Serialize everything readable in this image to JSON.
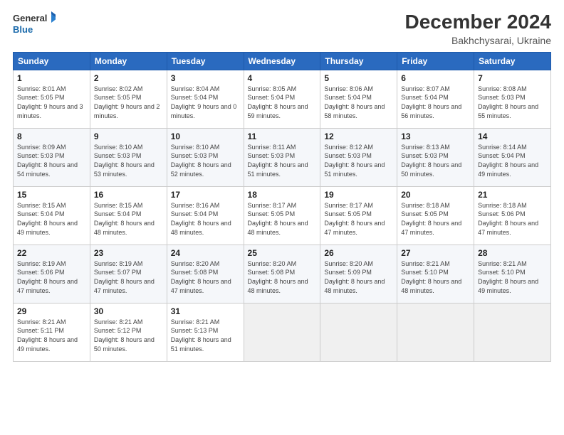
{
  "logo": {
    "line1": "General",
    "line2": "Blue"
  },
  "title": "December 2024",
  "subtitle": "Bakhchysarai, Ukraine",
  "weekdays": [
    "Sunday",
    "Monday",
    "Tuesday",
    "Wednesday",
    "Thursday",
    "Friday",
    "Saturday"
  ],
  "weeks": [
    [
      {
        "day": "1",
        "sunrise": "8:01 AM",
        "sunset": "5:05 PM",
        "daylight": "9 hours and 3 minutes."
      },
      {
        "day": "2",
        "sunrise": "8:02 AM",
        "sunset": "5:05 PM",
        "daylight": "9 hours and 2 minutes."
      },
      {
        "day": "3",
        "sunrise": "8:04 AM",
        "sunset": "5:04 PM",
        "daylight": "9 hours and 0 minutes."
      },
      {
        "day": "4",
        "sunrise": "8:05 AM",
        "sunset": "5:04 PM",
        "daylight": "8 hours and 59 minutes."
      },
      {
        "day": "5",
        "sunrise": "8:06 AM",
        "sunset": "5:04 PM",
        "daylight": "8 hours and 58 minutes."
      },
      {
        "day": "6",
        "sunrise": "8:07 AM",
        "sunset": "5:04 PM",
        "daylight": "8 hours and 56 minutes."
      },
      {
        "day": "7",
        "sunrise": "8:08 AM",
        "sunset": "5:03 PM",
        "daylight": "8 hours and 55 minutes."
      }
    ],
    [
      {
        "day": "8",
        "sunrise": "8:09 AM",
        "sunset": "5:03 PM",
        "daylight": "8 hours and 54 minutes."
      },
      {
        "day": "9",
        "sunrise": "8:10 AM",
        "sunset": "5:03 PM",
        "daylight": "8 hours and 53 minutes."
      },
      {
        "day": "10",
        "sunrise": "8:10 AM",
        "sunset": "5:03 PM",
        "daylight": "8 hours and 52 minutes."
      },
      {
        "day": "11",
        "sunrise": "8:11 AM",
        "sunset": "5:03 PM",
        "daylight": "8 hours and 51 minutes."
      },
      {
        "day": "12",
        "sunrise": "8:12 AM",
        "sunset": "5:03 PM",
        "daylight": "8 hours and 51 minutes."
      },
      {
        "day": "13",
        "sunrise": "8:13 AM",
        "sunset": "5:03 PM",
        "daylight": "8 hours and 50 minutes."
      },
      {
        "day": "14",
        "sunrise": "8:14 AM",
        "sunset": "5:04 PM",
        "daylight": "8 hours and 49 minutes."
      }
    ],
    [
      {
        "day": "15",
        "sunrise": "8:15 AM",
        "sunset": "5:04 PM",
        "daylight": "8 hours and 49 minutes."
      },
      {
        "day": "16",
        "sunrise": "8:15 AM",
        "sunset": "5:04 PM",
        "daylight": "8 hours and 48 minutes."
      },
      {
        "day": "17",
        "sunrise": "8:16 AM",
        "sunset": "5:04 PM",
        "daylight": "8 hours and 48 minutes."
      },
      {
        "day": "18",
        "sunrise": "8:17 AM",
        "sunset": "5:05 PM",
        "daylight": "8 hours and 48 minutes."
      },
      {
        "day": "19",
        "sunrise": "8:17 AM",
        "sunset": "5:05 PM",
        "daylight": "8 hours and 47 minutes."
      },
      {
        "day": "20",
        "sunrise": "8:18 AM",
        "sunset": "5:05 PM",
        "daylight": "8 hours and 47 minutes."
      },
      {
        "day": "21",
        "sunrise": "8:18 AM",
        "sunset": "5:06 PM",
        "daylight": "8 hours and 47 minutes."
      }
    ],
    [
      {
        "day": "22",
        "sunrise": "8:19 AM",
        "sunset": "5:06 PM",
        "daylight": "8 hours and 47 minutes."
      },
      {
        "day": "23",
        "sunrise": "8:19 AM",
        "sunset": "5:07 PM",
        "daylight": "8 hours and 47 minutes."
      },
      {
        "day": "24",
        "sunrise": "8:20 AM",
        "sunset": "5:08 PM",
        "daylight": "8 hours and 47 minutes."
      },
      {
        "day": "25",
        "sunrise": "8:20 AM",
        "sunset": "5:08 PM",
        "daylight": "8 hours and 48 minutes."
      },
      {
        "day": "26",
        "sunrise": "8:20 AM",
        "sunset": "5:09 PM",
        "daylight": "8 hours and 48 minutes."
      },
      {
        "day": "27",
        "sunrise": "8:21 AM",
        "sunset": "5:10 PM",
        "daylight": "8 hours and 48 minutes."
      },
      {
        "day": "28",
        "sunrise": "8:21 AM",
        "sunset": "5:10 PM",
        "daylight": "8 hours and 49 minutes."
      }
    ],
    [
      {
        "day": "29",
        "sunrise": "8:21 AM",
        "sunset": "5:11 PM",
        "daylight": "8 hours and 49 minutes."
      },
      {
        "day": "30",
        "sunrise": "8:21 AM",
        "sunset": "5:12 PM",
        "daylight": "8 hours and 50 minutes."
      },
      {
        "day": "31",
        "sunrise": "8:21 AM",
        "sunset": "5:13 PM",
        "daylight": "8 hours and 51 minutes."
      },
      null,
      null,
      null,
      null
    ]
  ]
}
